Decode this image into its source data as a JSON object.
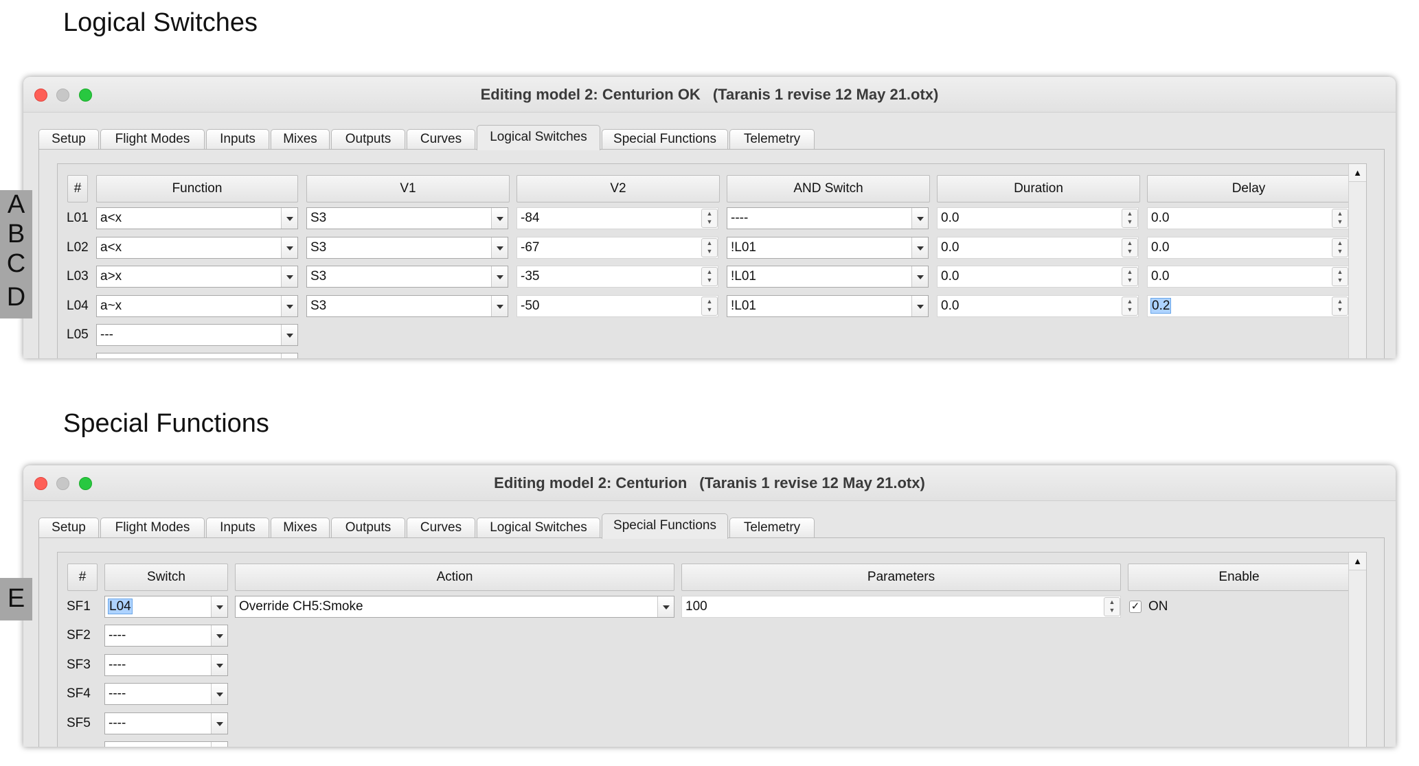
{
  "headings": {
    "logical": "Logical Switches",
    "special": "Special Functions"
  },
  "tabs": [
    "Setup",
    "Flight Modes",
    "Inputs",
    "Mixes",
    "Outputs",
    "Curves",
    "Logical Switches",
    "Special Functions",
    "Telemetry"
  ],
  "logical_window": {
    "title_left": "Editing model 2: Centurion OK",
    "title_right": "(Taranis 1 revise 12 May 21.otx)",
    "active_tab": "Logical Switches",
    "columns": [
      "#",
      "Function",
      "V1",
      "V2",
      "AND Switch",
      "Duration",
      "Delay"
    ],
    "markers": [
      "A",
      "B",
      "C",
      "D"
    ],
    "rows": [
      {
        "id": "L01",
        "function": "a<x",
        "v1": "S3",
        "v2": "-84",
        "and_switch": "----",
        "duration": "0.0",
        "delay": "0.0"
      },
      {
        "id": "L02",
        "function": "a<x",
        "v1": "S3",
        "v2": "-67",
        "and_switch": "!L01",
        "duration": "0.0",
        "delay": "0.0"
      },
      {
        "id": "L03",
        "function": "a>x",
        "v1": "S3",
        "v2": "-35",
        "and_switch": "!L01",
        "duration": "0.0",
        "delay": "0.0"
      },
      {
        "id": "L04",
        "function": "a~x",
        "v1": "S3",
        "v2": "-50",
        "and_switch": "!L01",
        "duration": "0.0",
        "delay": "0.2"
      }
    ],
    "empty_row": {
      "id": "L05",
      "function": "---"
    }
  },
  "special_window": {
    "title_left": "Editing model 2: Centurion",
    "title_right": "(Taranis 1 revise 12 May 21.otx)",
    "active_tab": "Special Functions",
    "columns": [
      "#",
      "Switch",
      "Action",
      "Parameters",
      "Enable"
    ],
    "marker": "E",
    "first_row": {
      "id": "SF1",
      "switch": "L04",
      "action": "Override CH5:Smoke",
      "parameter": "100",
      "enable_checked": true,
      "enable_label": "ON"
    },
    "empty_rows": [
      {
        "id": "SF2",
        "switch": "----"
      },
      {
        "id": "SF3",
        "switch": "----"
      },
      {
        "id": "SF4",
        "switch": "----"
      },
      {
        "id": "SF5",
        "switch": "----"
      }
    ]
  },
  "icons": {
    "checkmark": "✓",
    "scroll_up": "▲",
    "spin_up": "▲",
    "spin_down": "▼"
  }
}
